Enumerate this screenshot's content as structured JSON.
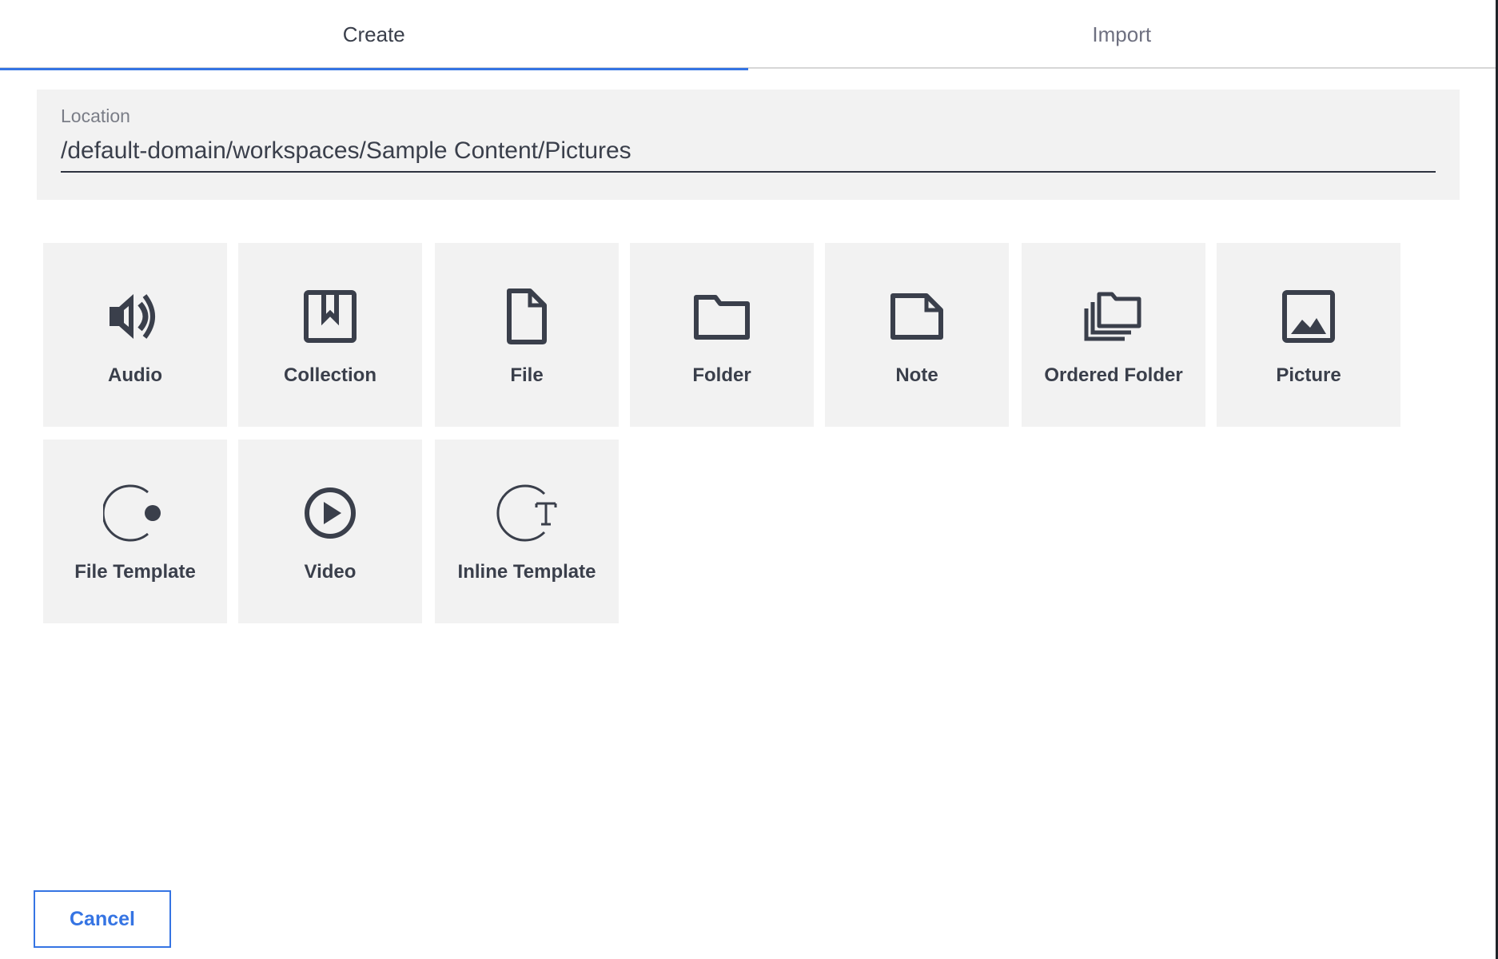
{
  "tabs": [
    {
      "label": "Create",
      "active": true
    },
    {
      "label": "Import",
      "active": false
    }
  ],
  "location": {
    "label": "Location",
    "value": "/default-domain/workspaces/Sample Content/Pictures"
  },
  "doc_types": [
    {
      "label": "Audio",
      "icon": "audio-icon"
    },
    {
      "label": "Collection",
      "icon": "collection-icon"
    },
    {
      "label": "File",
      "icon": "file-icon"
    },
    {
      "label": "Folder",
      "icon": "folder-icon"
    },
    {
      "label": "Note",
      "icon": "note-icon"
    },
    {
      "label": "Ordered Folder",
      "icon": "ordered-folder-icon"
    },
    {
      "label": "Picture",
      "icon": "picture-icon"
    },
    {
      "label": "File Template",
      "icon": "file-template-icon"
    },
    {
      "label": "Video",
      "icon": "video-icon"
    },
    {
      "label": "Inline Template",
      "icon": "inline-template-icon"
    }
  ],
  "actions": {
    "cancel_label": "Cancel"
  },
  "colors": {
    "accent": "#3574e3",
    "tile_bg": "#f2f2f2",
    "text": "#3a3f4b",
    "muted": "#6e7080"
  }
}
